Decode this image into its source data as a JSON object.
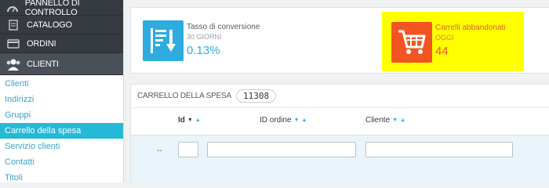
{
  "sidebar": {
    "menu": [
      {
        "label": "PANNELLO DI CONTROLLO",
        "icon": "dashboard-icon"
      },
      {
        "label": "CATALOGO",
        "icon": "catalog-icon"
      },
      {
        "label": "ORDINI",
        "icon": "orders-icon"
      },
      {
        "label": "CLIENTI",
        "icon": "customers-icon"
      }
    ],
    "sub_items": [
      {
        "label": "Clienti"
      },
      {
        "label": "Indirizzi"
      },
      {
        "label": "Gruppi"
      },
      {
        "label": "Carrello della spesa",
        "selected": true
      },
      {
        "label": "Servizio clienti"
      },
      {
        "label": "Contatti"
      },
      {
        "label": "Titoli"
      }
    ]
  },
  "kpis": [
    {
      "title": "Tasso di conversione",
      "subtitle": "30 GIORNI",
      "value": "0.13%",
      "icon": "conversion-chart-icon",
      "color": "#2eacdf"
    },
    {
      "title": "Carrelli abbandonati",
      "subtitle": "OGGI",
      "value": "44",
      "icon": "shopping-cart-icon",
      "color": "#f25522",
      "highlight": "#ffff00"
    }
  ],
  "panel": {
    "title": "CARRELLO DELLA SPESA",
    "count": "11308",
    "columns": [
      {
        "label": "Id"
      },
      {
        "label": "ID ordine"
      },
      {
        "label": "Cliente"
      }
    ],
    "filter_row_prefix": "--"
  },
  "colors": {
    "sidebar_dark": "#363a41",
    "accent": "#25b9d7",
    "link": "#3aa3c9"
  }
}
